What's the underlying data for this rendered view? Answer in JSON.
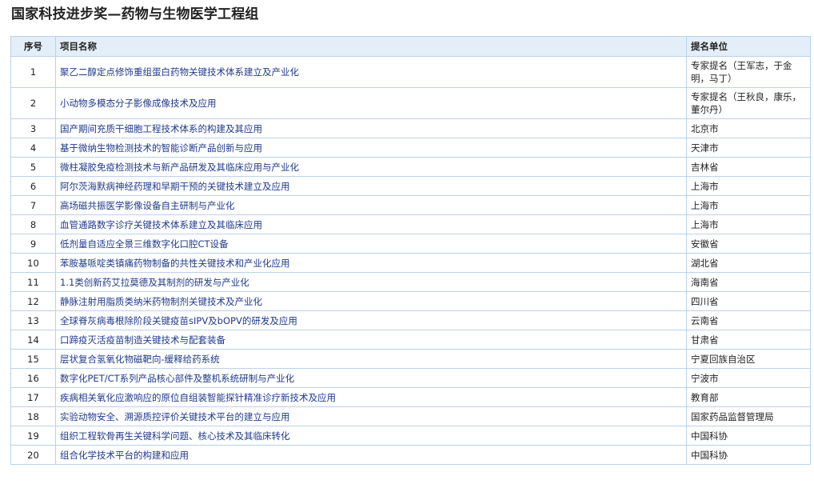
{
  "page": {
    "title": "国家科技进步奖—药物与生物医学工程组"
  },
  "table": {
    "headers": {
      "num": "序号",
      "name": "项目名称",
      "unit": "提名单位"
    },
    "rows": [
      {
        "num": "1",
        "name": "聚乙二醇定点修饰重组蛋白药物关键技术体系建立及产业化",
        "unit": "专家提名（王军志，于金明，马丁）"
      },
      {
        "num": "2",
        "name": "小动物多模态分子影像成像技术及应用",
        "unit": "专家提名（王秋良，康乐，董尔丹）"
      },
      {
        "num": "3",
        "name": "国产期间充质干细胞工程技术体系的构建及其应用",
        "unit": "北京市"
      },
      {
        "num": "4",
        "name": "基于微纳生物检测技术的智能诊断产品创新与应用",
        "unit": "天津市"
      },
      {
        "num": "5",
        "name": "微柱凝胶免疫检测技术与新产品研发及其临床应用与产业化",
        "unit": "吉林省"
      },
      {
        "num": "6",
        "name": "阿尔茨海默病神经药理和早期干预的关键技术建立及应用",
        "unit": "上海市"
      },
      {
        "num": "7",
        "name": "高场磁共振医学影像设备自主研制与产业化",
        "unit": "上海市"
      },
      {
        "num": "8",
        "name": "血管通路数字诊疗关键技术体系建立及其临床应用",
        "unit": "上海市"
      },
      {
        "num": "9",
        "name": "低剂量自适应全景三维数字化口腔CT设备",
        "unit": "安徽省"
      },
      {
        "num": "10",
        "name": "苯胺基哌啶类镇痛药物制备的共性关键技术和产业化应用",
        "unit": "湖北省"
      },
      {
        "num": "11",
        "name": "1.1类创新药艾拉莫德及其制剂的研发与产业化",
        "unit": "海南省"
      },
      {
        "num": "12",
        "name": "静脉注射用脂质类纳米药物制剂关键技术及产业化",
        "unit": "四川省"
      },
      {
        "num": "13",
        "name": "全球脊灰病毒根除阶段关键疫苗sIPV及bOPV的研发及应用",
        "unit": "云南省"
      },
      {
        "num": "14",
        "name": "口蹄疫灭活疫苗制造关键技术与配套装备",
        "unit": "甘肃省"
      },
      {
        "num": "15",
        "name": "层状复合氢氧化物磁靶向-缓释给药系统",
        "unit": "宁夏回族自治区"
      },
      {
        "num": "16",
        "name": "数字化PET/CT系列产品核心部件及整机系统研制与产业化",
        "unit": "宁波市"
      },
      {
        "num": "17",
        "name": "疾病相关氧化应激响应的原位自组装智能探针精准诊疗新技术及应用",
        "unit": "教育部"
      },
      {
        "num": "18",
        "name": "实验动物安全、溯源质控评价关键技术平台的建立与应用",
        "unit": "国家药品监督管理局"
      },
      {
        "num": "19",
        "name": "组织工程软骨再生关键科学问题、核心技术及其临床转化",
        "unit": "中国科协"
      },
      {
        "num": "20",
        "name": "组合化学技术平台的构建和应用",
        "unit": "中国科协"
      }
    ]
  },
  "colors": {
    "link": "#1f3a8a",
    "header_bg": "#e4eef8",
    "border": "#b9d2e8"
  }
}
